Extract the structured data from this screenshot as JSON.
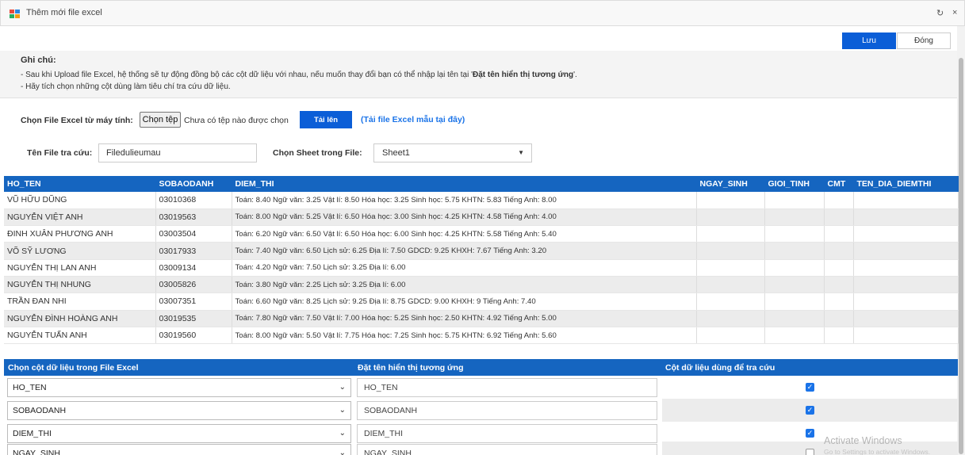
{
  "window": {
    "title": "Thêm mới file excel",
    "refresh_glyph": "↻",
    "close_glyph": "×"
  },
  "actions": {
    "save_label": "Lưu",
    "close_label": "Đóng"
  },
  "notes": {
    "title": "Ghi chú:",
    "line1_prefix": "- Sau khi Upload file Excel, hệ thống sẽ tự động đồng bộ các cột dữ liệu với nhau, nếu muốn thay đổi bạn có thể nhập lại tên tại '",
    "line1_bold": "Đặt tên hiển thị tương ứng",
    "line1_suffix": "'.",
    "line2": "- Hãy tích chọn những cột dùng làm tiêu chí tra cứu dữ liệu."
  },
  "upload": {
    "label": "Chọn File Excel từ máy tính:",
    "choose_button": "Chọn tệp",
    "no_file_text": "Chưa có tệp nào được chọn",
    "upload_button": "Tải lên",
    "sample_link": "(Tải file Excel mẫu tại đây)"
  },
  "form": {
    "file_name_label": "Tên File tra cứu:",
    "file_name_value": "Filedulieumau",
    "sheet_label": "Chọn Sheet trong File:",
    "sheet_value": "Sheet1"
  },
  "table": {
    "columns": [
      "HO_TEN",
      "SOBAODANH",
      "DIEM_THI",
      "NGAY_SINH",
      "GIOI_TINH",
      "CMT",
      "TEN_DIA_DIEMTHI"
    ],
    "rows": [
      [
        "VŨ HỮU DŨNG",
        "03010368",
        "Toán: 8.40 Ngữ văn: 3.25 Vật lí: 8.50 Hóa học: 3.25 Sinh học: 5.75 KHTN: 5.83 Tiếng Anh: 8.00",
        "",
        "",
        "",
        ""
      ],
      [
        "NGUYỄN VIỆT ANH",
        "03019563",
        "Toán: 8.00 Ngữ văn: 5.25 Vật lí: 6.50 Hóa học: 3.00 Sinh học: 4.25 KHTN: 4.58 Tiếng Anh: 4.00",
        "",
        "",
        "",
        ""
      ],
      [
        "ĐINH XUÂN PHƯƠNG ANH",
        "03003504",
        "Toán: 6.20 Ngữ văn: 6.50 Vật lí: 6.50 Hóa học: 6.00 Sinh học: 4.25 KHTN: 5.58 Tiếng Anh: 5.40",
        "",
        "",
        "",
        ""
      ],
      [
        "VÕ SỸ LƯƠNG",
        "03017933",
        "Toán: 7.40 Ngữ văn: 6.50 Lịch sử: 6.25 Địa lí: 7.50 GDCD: 9.25 KHXH: 7.67 Tiếng Anh: 3.20",
        "",
        "",
        "",
        ""
      ],
      [
        "NGUYỄN THỊ LAN ANH",
        "03009134",
        "Toán: 4.20 Ngữ văn: 7.50 Lịch sử: 3.25 Địa lí: 6.00",
        "",
        "",
        "",
        ""
      ],
      [
        "NGUYỄN THỊ NHUNG",
        "03005826",
        "Toán: 3.80 Ngữ văn: 2.25 Lịch sử: 3.25 Địa lí: 6.00",
        "",
        "",
        "",
        ""
      ],
      [
        "TRẦN ĐAN NHI",
        "03007351",
        "Toán: 6.60 Ngữ văn: 8.25 Lịch sử: 9.25 Địa lí: 8.75 GDCD: 9.00 KHXH: 9 Tiếng Anh: 7.40",
        "",
        "",
        "",
        ""
      ],
      [
        "NGUYỄN ĐÌNH HOÀNG ANH",
        "03019535",
        "Toán: 7.80 Ngữ văn: 7.50 Vật lí: 7.00 Hóa học: 5.25 Sinh học: 2.50 KHTN: 4.92 Tiếng Anh: 5.00",
        "",
        "",
        "",
        ""
      ],
      [
        "NGUYỄN TUẤN ANH",
        "03019560",
        "Toán: 8.00 Ngữ văn: 5.50 Vật lí: 7.75 Hóa học: 7.25 Sinh học: 5.75 KHTN: 6.92 Tiếng Anh: 5.60",
        "",
        "",
        "",
        ""
      ]
    ]
  },
  "mapping": {
    "header_column": "Chọn cột dữ liệu trong File Excel",
    "header_display": "Đặt tên hiển thị tương ứng",
    "header_lookup": "Cột dữ liệu dùng để tra cứu",
    "rows": [
      {
        "column": "HO_TEN",
        "display": "HO_TEN",
        "checked": true
      },
      {
        "column": "SOBAODANH",
        "display": "SOBAODANH",
        "checked": true
      },
      {
        "column": "DIEM_THI",
        "display": "DIEM_THI",
        "checked": true
      },
      {
        "column": "NGAY_SINH",
        "display": "NGAY_SINH",
        "checked": false
      }
    ]
  },
  "watermark": {
    "line1": "Activate Windows",
    "line2": "Go to Settings to activate Windows."
  },
  "colors": {
    "primary": "#1565c0",
    "button": "#0b5ed7",
    "link": "#1a73e8"
  }
}
